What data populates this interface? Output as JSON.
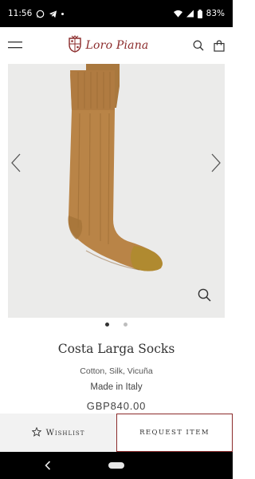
{
  "status_bar": {
    "time": "11:56",
    "battery": "83%",
    "icons": [
      "whatsapp-icon",
      "telegram-icon",
      "dot-icon",
      "wifi-icon",
      "signal-icon",
      "battery-icon"
    ]
  },
  "header": {
    "brand": "Loro Piana",
    "icons": [
      "menu-icon",
      "search-icon",
      "shopping-bag-icon"
    ]
  },
  "gallery": {
    "image": "Camel ribbed knee-high socks",
    "slide_count": 2,
    "active_slide": 1,
    "icons": [
      "chevron-left-icon",
      "chevron-right-icon",
      "zoom-icon"
    ]
  },
  "product": {
    "name": "Costa Larga Socks",
    "material": "Cotton, Silk, Vicuña",
    "origin": "Made in Italy",
    "price": "GBP840.00"
  },
  "actions": {
    "wishlist_label": "Wishlist",
    "request_label": "REQUEST ITEM"
  },
  "colors": {
    "brand": "#8b2b2b",
    "sock": "#b98447",
    "sock_shadow": "#9a6a33",
    "toe": "#b08a30",
    "background": "#ebebea"
  }
}
